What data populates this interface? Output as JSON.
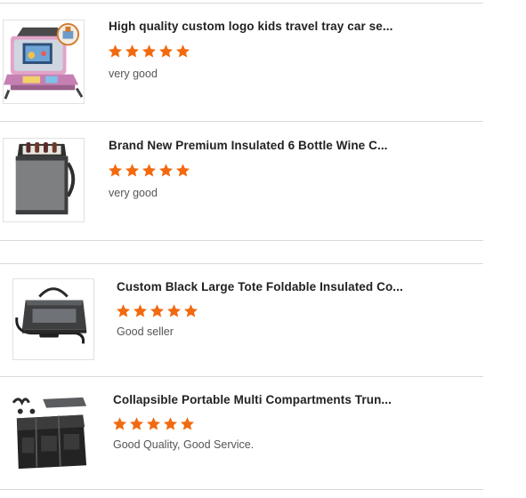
{
  "accent_color": "#f26a10",
  "reviews": [
    {
      "title": "High quality custom logo kids travel tray car se...",
      "rating": 5,
      "review_text": "very good",
      "image_icon": "kids-travel-tray-image"
    },
    {
      "title": "Brand New Premium Insulated 6 Bottle Wine C...",
      "rating": 5,
      "review_text": "very good",
      "image_icon": "insulated-wine-cooler-bag-image"
    },
    {
      "title": "Custom Black Large Tote Foldable Insulated Co...",
      "rating": 5,
      "review_text": "Good seller",
      "image_icon": "insulated-tote-bag-image"
    },
    {
      "title": "Collapsible Portable Multi Compartments Trun...",
      "rating": 5,
      "review_text": "Good Quality, Good Service.",
      "image_icon": "trunk-organizer-image"
    }
  ]
}
